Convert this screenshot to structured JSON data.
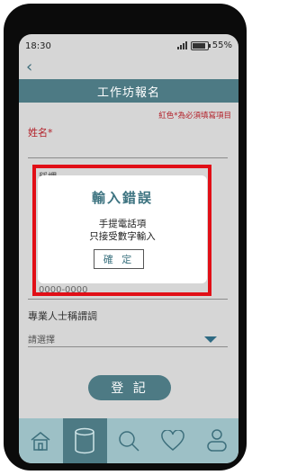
{
  "status_bar": {
    "time": "18:30",
    "battery": "55%"
  },
  "header": {
    "title": "工作坊報名"
  },
  "form": {
    "required_note": "紅色*為必須填寫項目",
    "name_label": "姓名*",
    "title_label": "稱謂",
    "phone_placeholder": "0000-0000",
    "pro_title_label": "專業人士稱謂調",
    "pro_title_select": "請選擇",
    "submit_label": "登 記"
  },
  "dialog": {
    "title": "輸入錯誤",
    "line1": "手提電話項",
    "line2": "只接受數字輸入",
    "confirm_label": "確 定"
  },
  "nav": {
    "items": [
      "home-icon",
      "database-icon",
      "search-icon",
      "heart-icon",
      "profile-icon"
    ],
    "active_index": 1
  },
  "colors": {
    "accent": "#4d7a84",
    "required": "#b3212a",
    "error_border": "#e10f17",
    "nav_bg": "#9dc0c6"
  }
}
